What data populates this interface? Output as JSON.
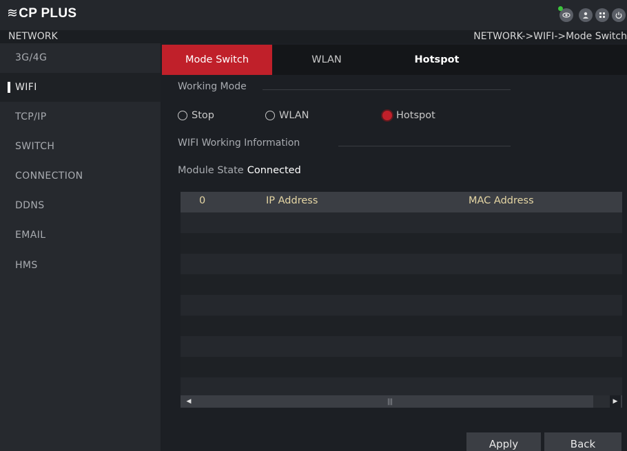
{
  "header": {
    "logo_mark": "≋",
    "logo_text": "CP PLUS",
    "icons": [
      "view-icon",
      "user-icon",
      "grid-icon",
      "power-icon"
    ],
    "status_dot_color": "#3cc43c"
  },
  "pathbar": {
    "section": "NETWORK",
    "breadcrumb": "NETWORK->WIFI->Mode Switch"
  },
  "sidebar": {
    "items": [
      {
        "label": "3G/4G"
      },
      {
        "label": "WIFI"
      },
      {
        "label": "TCP/IP"
      },
      {
        "label": "SWITCH"
      },
      {
        "label": "CONNECTION"
      },
      {
        "label": "DDNS"
      },
      {
        "label": "EMAIL"
      },
      {
        "label": "HMS"
      }
    ],
    "active_index": 1
  },
  "tabs": [
    {
      "label": "Mode Switch"
    },
    {
      "label": "WLAN"
    },
    {
      "label": "Hotspot"
    }
  ],
  "working_mode": {
    "label": "Working Mode",
    "options": [
      {
        "label": "Stop"
      },
      {
        "label": "WLAN"
      },
      {
        "label": "Hotspot"
      }
    ],
    "selected": "Hotspot"
  },
  "wifi_info": {
    "label": "WIFI Working Information",
    "module_state_label": "Module State",
    "module_state_value": "Connected"
  },
  "table": {
    "columns": [
      "0",
      "IP Address",
      "MAC Address"
    ],
    "rows": []
  },
  "buttons": {
    "apply": "Apply",
    "back": "Back"
  },
  "colors": {
    "accent": "#c0202a",
    "header_text": "#e5d6a4"
  }
}
